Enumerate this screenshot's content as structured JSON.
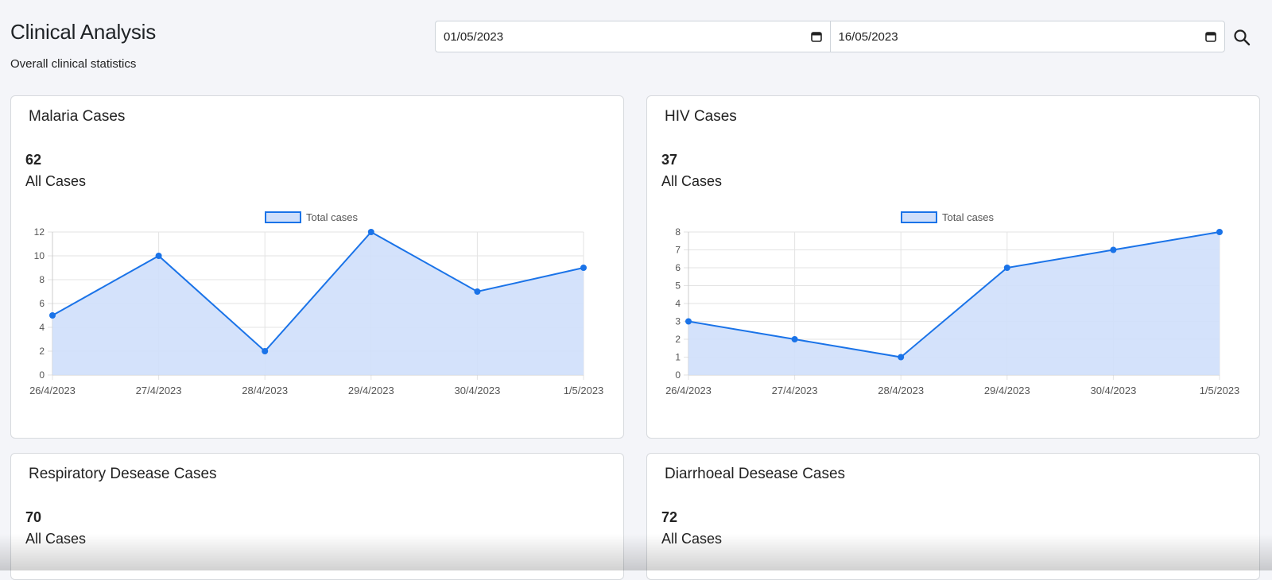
{
  "header": {
    "title": "Clinical Analysis",
    "subtitle": "Overall clinical statistics"
  },
  "filters": {
    "start_date": "01/05/2023",
    "end_date": "16/05/2023",
    "search_icon": "search-icon",
    "calendar_icon": "calendar-icon"
  },
  "colors": {
    "line": "#1a73e8",
    "fill": "#cfdffb",
    "grid": "#e3e3e3"
  },
  "cards": [
    {
      "title": "Malaria Cases",
      "count": "62",
      "count_label": "All Cases"
    },
    {
      "title": "HIV Cases",
      "count": "37",
      "count_label": "All Cases"
    },
    {
      "title": "Respiratory Desease Cases",
      "count": "70",
      "count_label": "All Cases"
    },
    {
      "title": "Diarrhoeal Desease Cases",
      "count": "72",
      "count_label": "All Cases"
    }
  ],
  "chart_data": [
    {
      "type": "area",
      "title": "",
      "x": [
        "26/4/2023",
        "27/4/2023",
        "28/4/2023",
        "29/4/2023",
        "30/4/2023",
        "1/5/2023"
      ],
      "series": [
        {
          "name": "Total cases",
          "values": [
            5,
            10,
            2,
            12,
            7,
            9
          ]
        }
      ],
      "ylim": [
        0,
        12
      ],
      "yticks": [
        0,
        2,
        4,
        6,
        8,
        10,
        12
      ],
      "legend": "top",
      "grid": true
    },
    {
      "type": "area",
      "title": "",
      "x": [
        "26/4/2023",
        "27/4/2023",
        "28/4/2023",
        "29/4/2023",
        "30/4/2023",
        "1/5/2023"
      ],
      "series": [
        {
          "name": "Total cases",
          "values": [
            3,
            2,
            1,
            6,
            7,
            8
          ]
        }
      ],
      "ylim": [
        0,
        8
      ],
      "yticks": [
        0,
        1,
        2,
        3,
        4,
        5,
        6,
        7,
        8
      ],
      "legend": "top",
      "grid": true
    }
  ]
}
